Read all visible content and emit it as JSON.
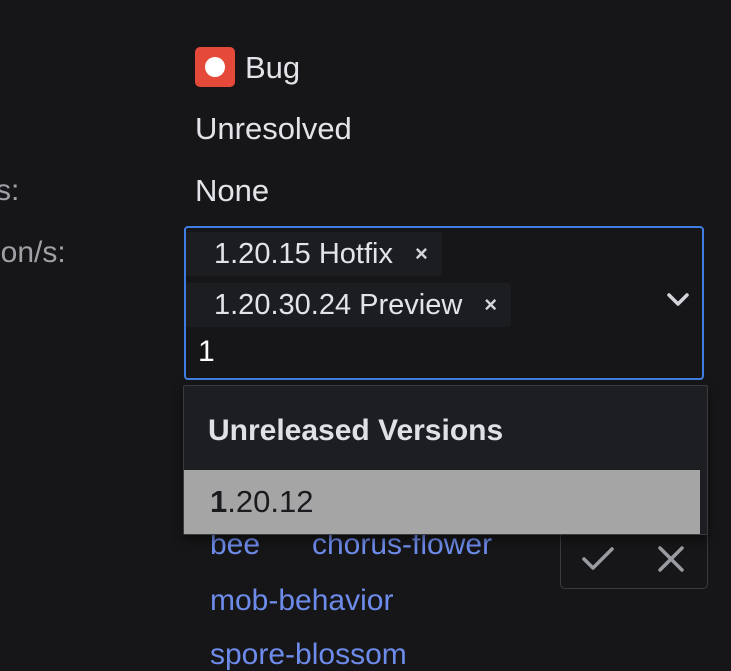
{
  "labels": {
    "row3_label_fragment": "s:",
    "row4_label_fragment": "ion/s:"
  },
  "issue": {
    "type": "Bug",
    "resolution": "Unresolved",
    "row3_value": "None"
  },
  "version_select": {
    "chips": [
      {
        "label": "1.20.15 Hotfix",
        "remove": "×"
      },
      {
        "label": "1.20.30.24 Preview",
        "remove": "×"
      }
    ],
    "typed_value": "1"
  },
  "dropdown": {
    "heading": "Unreleased Versions",
    "options": [
      {
        "match": "1",
        "rest": ".20.12"
      }
    ]
  },
  "label_tags": [
    "bee",
    "chorus-flower",
    "mob-behavior",
    "spore-blossom"
  ],
  "colors": {
    "accent": "#3f7de0",
    "bug_icon": "#e5493a",
    "tag_link": "#6d8bea",
    "highlight": "#a5a5a5"
  },
  "icons": {
    "bug": "bug-icon",
    "chevron": "chevron-down-icon",
    "confirm": "check-icon",
    "cancel": "close-icon"
  }
}
